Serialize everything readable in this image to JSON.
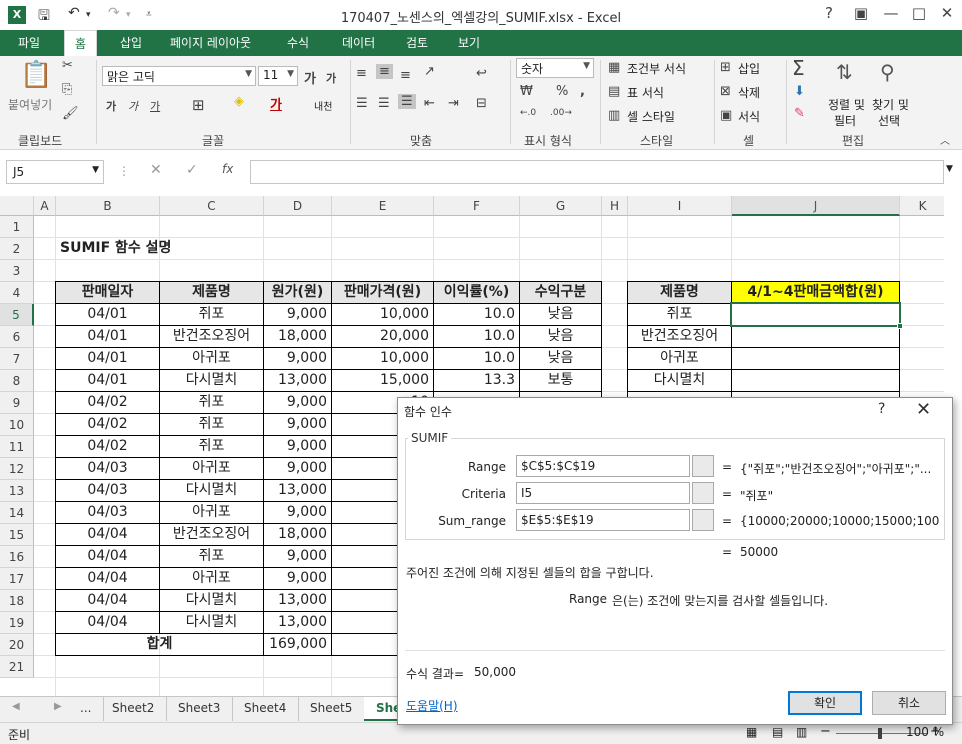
{
  "window": {
    "title": "170407_노센스의_엑셀강의_SUMIF.xlsx - Excel",
    "logo": "X",
    "help": "?",
    "minimize": "—",
    "maximize": "□",
    "close": "✕"
  },
  "ribbon_tabs": [
    "파일",
    "홈",
    "삽입",
    "페이지 레이아웃",
    "수식",
    "데이터",
    "검토",
    "보기"
  ],
  "ribbon": {
    "paste": "붙여넣기",
    "font_name": "맑은 고딕",
    "font_size": "11",
    "wrap": "내천",
    "number_format": "숫자",
    "conditional": "조건부 서식",
    "as_table": "표 서식",
    "cell_style": "셀 스타일",
    "insert": "삽입",
    "delete": "삭제",
    "format": "서식",
    "sort_filter_1": "정렬 및",
    "sort_filter_2": "필터",
    "find_select_1": "찾기 및",
    "find_select_2": "선택",
    "groups": [
      "클립보드",
      "글꼴",
      "맞춤",
      "표시 형식",
      "스타일",
      "셀",
      "편집"
    ]
  },
  "formula_bar": {
    "name_box": "J5",
    "fx": "fx",
    "content": ""
  },
  "columns": [
    "A",
    "B",
    "C",
    "D",
    "E",
    "F",
    "G",
    "H",
    "I",
    "J",
    "K"
  ],
  "rows": [
    "1",
    "2",
    "3",
    "4",
    "5",
    "6",
    "7",
    "8",
    "9",
    "10",
    "11",
    "12",
    "13",
    "14",
    "15",
    "16",
    "17",
    "18",
    "19",
    "20",
    "21"
  ],
  "sheet": {
    "title": "SUMIF 함수 설명",
    "headers": [
      "판매일자",
      "제품명",
      "원가(원)",
      "판매가격(원)",
      "이익률(%)",
      "수익구분"
    ],
    "data": [
      [
        "04/01",
        "쥐포",
        "9,000",
        "10,000",
        "10.0",
        "낮음"
      ],
      [
        "04/01",
        "반건조오징어",
        "18,000",
        "20,000",
        "10.0",
        "낮음"
      ],
      [
        "04/01",
        "아귀포",
        "9,000",
        "10,000",
        "10.0",
        "낮음"
      ],
      [
        "04/01",
        "다시멸치",
        "13,000",
        "15,000",
        "13.3",
        "보통"
      ],
      [
        "04/02",
        "쥐포",
        "9,000",
        "10",
        "",
        ""
      ],
      [
        "04/02",
        "쥐포",
        "9,000",
        "10",
        "",
        ""
      ],
      [
        "04/02",
        "쥐포",
        "9,000",
        "10",
        "",
        ""
      ],
      [
        "04/03",
        "아귀포",
        "9,000",
        "10",
        "",
        ""
      ],
      [
        "04/03",
        "다시멸치",
        "13,000",
        "15",
        "",
        ""
      ],
      [
        "04/03",
        "아귀포",
        "9,000",
        "10",
        "",
        ""
      ],
      [
        "04/04",
        "반건조오징어",
        "18,000",
        "20",
        "",
        ""
      ],
      [
        "04/04",
        "쥐포",
        "9,000",
        "10",
        "",
        ""
      ],
      [
        "04/04",
        "아귀포",
        "9,000",
        "10",
        "",
        ""
      ],
      [
        "04/04",
        "다시멸치",
        "13,000",
        "15",
        "",
        ""
      ],
      [
        "04/04",
        "다시멸치",
        "13,000",
        "15",
        "",
        ""
      ]
    ],
    "total_label": "합계",
    "total_cost": "169,000",
    "total_price": "190",
    "summary_headers": [
      "제품명",
      "4/1~4판매금액합(원)"
    ],
    "summary_products": [
      "쥐포",
      "반건조오징어",
      "아귀포",
      "다시멸치"
    ]
  },
  "sheet_tabs": [
    "...",
    "Sheet2",
    "Sheet3",
    "Sheet4",
    "Sheet5",
    "She"
  ],
  "status": {
    "ready": "준비",
    "zoom": "100 %",
    "zoom_minus": "−",
    "zoom_plus": "+"
  },
  "dialog": {
    "title": "함수 인수",
    "help": "?",
    "close": "✕",
    "function_name": "SUMIF",
    "args": [
      {
        "label": "Range",
        "value": "$C$5:$C$19",
        "result": "{\"쥐포\";\"반건조오징어\";\"아귀포\";\"..."
      },
      {
        "label": "Criteria",
        "value": "I5",
        "result": "\"쥐포\""
      },
      {
        "label": "Sum_range",
        "value": "$E$5:$E$19",
        "result": "{10000;20000;10000;15000;1000..."
      }
    ],
    "eq": "=",
    "overall_result": "50000",
    "description": "주어진 조건에 의해 지정된 셀들의 합을 구합니다.",
    "arg_help_name": "Range",
    "arg_help_text": "은(는) 조건에 맞는지를 검사할 셀들입니다.",
    "formula_result_label": "수식 결과=",
    "formula_result_value": "50,000",
    "help_link": "도움말(H)",
    "ok": "확인",
    "cancel": "취소"
  }
}
